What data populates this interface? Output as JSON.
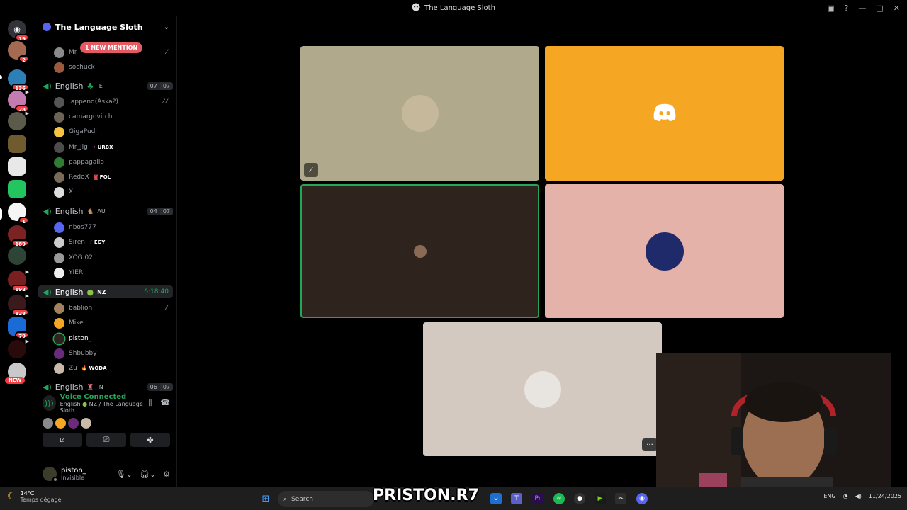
{
  "window": {
    "title": "The Language Sloth"
  },
  "rail": {
    "badges": [
      "19",
      "2",
      "136",
      "28",
      "192",
      "828",
      "79",
      "189",
      "1"
    ],
    "new_label": "NEW"
  },
  "guild": {
    "name": "The Language Sloth",
    "mention_pill": "1 NEW MENTION"
  },
  "top_users": [
    "sochuck"
  ],
  "partial_user": "Mr",
  "channels": [
    {
      "name": "English",
      "flag": "IE",
      "count_a": "07",
      "count_b": "07",
      "users": [
        ".append(Aska?)",
        "camargovitch",
        "GigaPudi",
        "Mr_Jig",
        "pappagallo",
        "RedoX",
        "X"
      ],
      "tags": {
        "Mr_Jig": "URBX",
        "RedoX": "POL"
      }
    },
    {
      "name": "English",
      "flag": "AU",
      "count_a": "04",
      "count_b": "07",
      "users": [
        "nbos777",
        "Siren",
        "XOG.02",
        "YIER"
      ],
      "tags": {
        "Siren": "EGY"
      }
    },
    {
      "name": "English",
      "flag": "NZ",
      "timer": "6:18:40",
      "users": [
        "bablion",
        "Mike",
        "piston_",
        "Shbubby",
        "Zu"
      ],
      "tags": {
        "Zu": "WÓDA"
      }
    },
    {
      "name": "English",
      "flag": "IN",
      "count_a": "06",
      "count_b": "07"
    }
  ],
  "voice": {
    "status": "Voice Connected",
    "location": "English",
    "location_flag": "NZ",
    "location_server": "/ The Language Sloth"
  },
  "user": {
    "name": "piston_",
    "status": "Invisible"
  },
  "tile_more_label": "···",
  "taskbar": {
    "weather_temp": "14°C",
    "weather_cond": "Temps dégagé",
    "search_placeholder": "Search",
    "watermark": "PRISTON.R7",
    "lang": "ENG",
    "date": "11/24/2025"
  },
  "colors": {
    "accent_green": "#23a55a",
    "tile_tan": "#b0a98c",
    "tile_orange": "#f5a623",
    "tile_brown": "#2f231d",
    "tile_pink": "#e5b2a9",
    "tile_beige": "#d4c9c0"
  }
}
